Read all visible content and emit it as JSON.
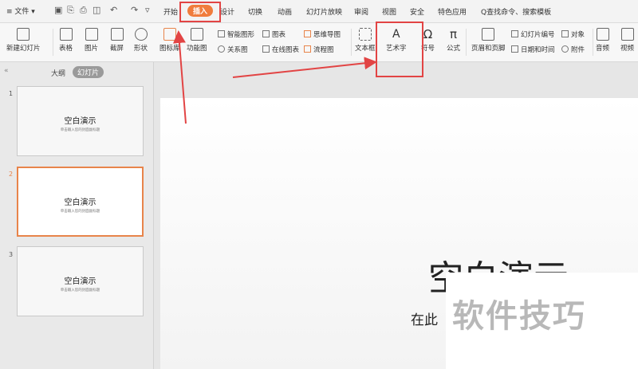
{
  "menubar": {
    "file_label": "≡ 文件 ▾",
    "tabs": [
      "开始",
      "插入",
      "设计",
      "切换",
      "动画",
      "幻灯片放映",
      "审阅",
      "视图",
      "安全",
      "特色应用"
    ],
    "active_tab": "插入",
    "search_label": "Q查找命令、搜索模板"
  },
  "toolbar": {
    "new_slide": "新建幻灯片",
    "table": "表格",
    "image": "图片",
    "crop": "截屏",
    "shape": "形状",
    "icon_lib": "图标库",
    "function_chart": "功能图",
    "smart_art": "智能图形",
    "chart": "图表",
    "relation": "关系图",
    "online_chart": "在线图表",
    "mind_map": "思维导图",
    "flowchart": "流程图",
    "text_box": "文本框",
    "art_text": "艺术字",
    "symbol": "符号",
    "formula": "公式",
    "header_footer": "页眉和页脚",
    "slide_number": "幻灯片编号",
    "object": "对象",
    "date_time": "日期和时间",
    "attachment": "附件",
    "audio": "音频",
    "video": "视频"
  },
  "panel": {
    "tab_outline": "大纲",
    "tab_slides": "幻灯片",
    "slides": [
      {
        "num": "1",
        "title": "空白演示",
        "sub": "单击输入您的封面副标题"
      },
      {
        "num": "2",
        "title": "空白演示",
        "sub": "单击输入您的封面副标题"
      },
      {
        "num": "3",
        "title": "空白演示",
        "sub": "单击输入您的封面副标题"
      }
    ]
  },
  "canvas": {
    "title": "空白演示",
    "subtitle": "在此"
  },
  "watermark": "软件技巧",
  "colors": {
    "accent": "#f07c3c",
    "annotation": "#e24444"
  }
}
